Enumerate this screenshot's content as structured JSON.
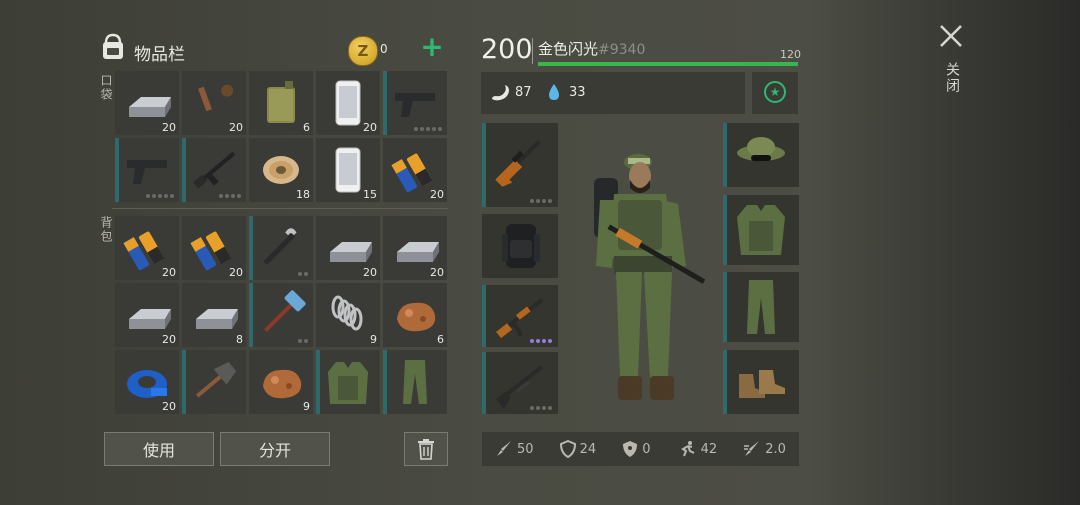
{
  "inventory": {
    "title": "物品栏",
    "coins": "0",
    "pocket_label": "口袋",
    "backpack_label": "背包",
    "use_label": "使用",
    "split_label": "分开",
    "pocket_slots": [
      {
        "item": "iron-ingot",
        "count": "20"
      },
      {
        "item": "tools",
        "count": "20"
      },
      {
        "item": "jerrycan",
        "count": "6"
      },
      {
        "item": "smartphone",
        "count": "20"
      },
      {
        "item": "pistol",
        "count": ""
      },
      {
        "item": "pistol",
        "count": ""
      },
      {
        "item": "assault-rifle",
        "count": ""
      },
      {
        "item": "wire-spool",
        "count": "18"
      },
      {
        "item": "smartphone",
        "count": "15"
      },
      {
        "item": "batteries",
        "count": "20"
      }
    ],
    "backpack_slots": [
      {
        "item": "batteries",
        "count": "20"
      },
      {
        "item": "batteries",
        "count": "20"
      },
      {
        "item": "crowbar",
        "count": ""
      },
      {
        "item": "iron-ingot",
        "count": "20"
      },
      {
        "item": "iron-ingot",
        "count": "20"
      },
      {
        "item": "iron-ingot",
        "count": "20"
      },
      {
        "item": "iron-ingot",
        "count": "8"
      },
      {
        "item": "sledgehammer",
        "count": ""
      },
      {
        "item": "spring",
        "count": "9"
      },
      {
        "item": "copper-ore",
        "count": "6"
      },
      {
        "item": "duct-tape",
        "count": "20"
      },
      {
        "item": "shovel",
        "count": ""
      },
      {
        "item": "copper-ore",
        "count": "9"
      },
      {
        "item": "vest",
        "count": ""
      },
      {
        "item": "pants",
        "count": ""
      }
    ]
  },
  "player": {
    "level": "200",
    "name": "金色闪光",
    "tag": "#9340",
    "max_label": "120",
    "hunger": "87",
    "thirst": "33"
  },
  "stats": {
    "attack": "50",
    "defense": "24",
    "radiation": "0",
    "speed": "42",
    "attack_speed": "2.0"
  },
  "close_label": "关闭",
  "colors": {
    "accent": "#2eb872",
    "slot_bar": "#2e6a6c",
    "panel": "#3a3b37"
  }
}
